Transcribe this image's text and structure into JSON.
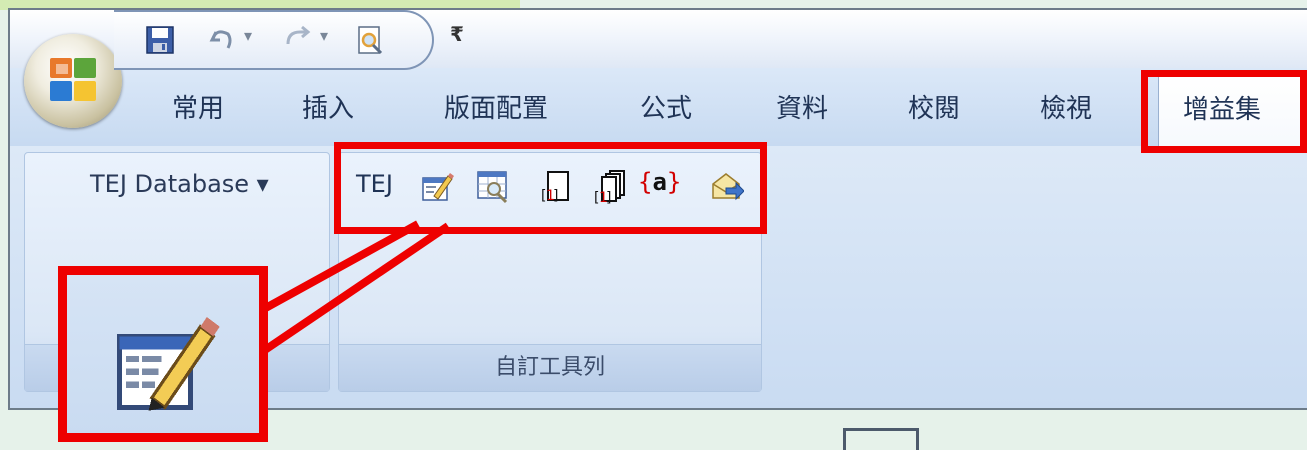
{
  "quick_access": {
    "save_icon": "save-icon",
    "undo_icon": "undo-icon",
    "redo_icon": "redo-icon",
    "print_preview_icon": "print-preview-icon",
    "dropdown_glyph": "▾",
    "customize_glyph": "₹"
  },
  "tabs": [
    {
      "label": "常用"
    },
    {
      "label": "插入"
    },
    {
      "label": "版面配置"
    },
    {
      "label": "公式"
    },
    {
      "label": "資料"
    },
    {
      "label": "校閱"
    },
    {
      "label": "檢視"
    },
    {
      "label": "增益集",
      "active": true
    }
  ],
  "groups": {
    "tej_database": {
      "label": "TEJ Database ▾"
    },
    "custom_toolbar": {
      "name": "自訂工具列",
      "tej_label": "TEJ",
      "icons": [
        "edit-form-icon",
        "preview-grid-icon",
        "single-sheet-icon",
        "multi-sheet-icon",
        "variable-braces-icon",
        "send-icon"
      ],
      "braces_text": "{a}"
    }
  },
  "colors": {
    "highlight": "#ee0000",
    "ribbon": "#d1e1f4",
    "window_frame": "#6d7c8a"
  }
}
